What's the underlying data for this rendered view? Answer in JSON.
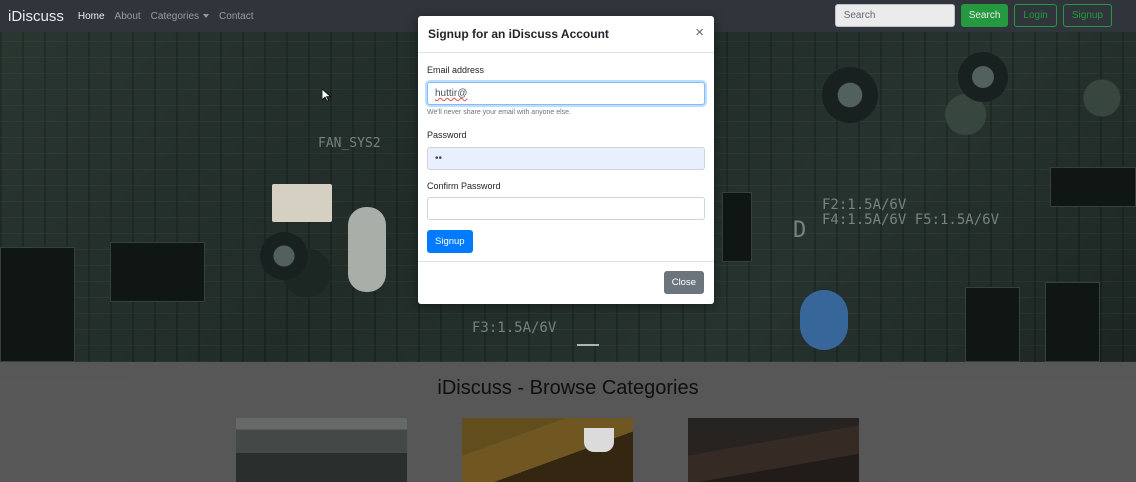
{
  "navbar": {
    "brand": "iDiscuss",
    "links": [
      "Home",
      "About",
      "Categories",
      "Contact"
    ],
    "search_placeholder": "Search",
    "search_button": "Search",
    "login_button": "Login",
    "signup_button": "Signup"
  },
  "hero": {
    "board_labels": [
      "F2:1.5A/6V",
      "F4:1.5A/6V F5:1.5A/6V",
      "F3:1.5A/6V",
      "FAN_SYS2",
      "D"
    ]
  },
  "section": {
    "title": "iDiscuss - Browse Categories"
  },
  "modal": {
    "title": "Signup for an iDiscuss Account",
    "close_glyph": "×",
    "email_label": "Email address",
    "email_value": "huttir@",
    "email_help": "We'll never share your email with anyone else.",
    "password_label": "Password",
    "password_value": "••",
    "confirm_label": "Confirm Password",
    "confirm_value": "",
    "submit_button": "Signup",
    "footer_close": "Close"
  },
  "colors": {
    "navbar_bg": "#343a40",
    "primary": "#007bff",
    "success": "#28a745",
    "secondary": "#6c757d"
  },
  "icons": [
    "caret-down-icon",
    "close-icon",
    "mouse-cursor-icon"
  ]
}
